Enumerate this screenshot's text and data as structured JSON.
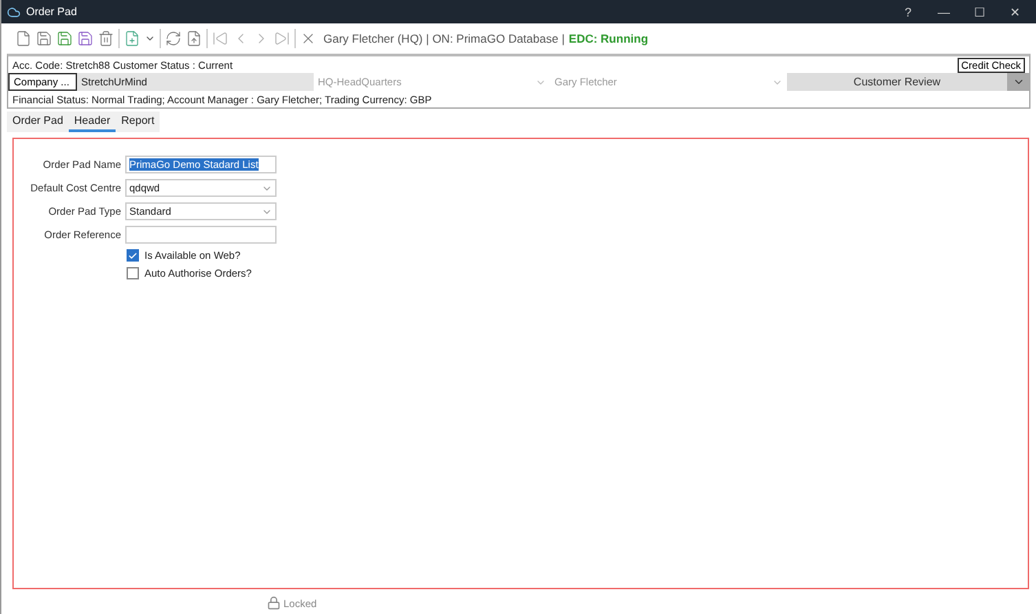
{
  "window": {
    "title": "Order Pad",
    "controls": [
      "?",
      "—",
      "☐",
      "✕"
    ]
  },
  "toolbar": {
    "user": "Gary Fletcher (HQ) | ON: PrimaGO Database |",
    "edc": "EDC: Running"
  },
  "customer": {
    "acc_code": "Acc. Code: Stretch88  Customer Status : Current",
    "credit_check": "Credit Check",
    "company_button": "Company ...",
    "company": "StretchUrMind",
    "branch": "HQ-HeadQuarters",
    "contact": "Gary Fletcher",
    "review": "Customer Review",
    "financial": "Financial Status: Normal Trading;  Account Manager : Gary Fletcher; Trading Currency: GBP"
  },
  "tabs": [
    {
      "label": "Order Pad",
      "selected": false
    },
    {
      "label": "Header",
      "selected": true
    },
    {
      "label": "Report",
      "selected": false
    }
  ],
  "form": {
    "fields": [
      {
        "kind": "text",
        "label": "Order Pad Name",
        "value": "PrimaGo Demo Stadard List",
        "highlighted": true
      },
      {
        "kind": "select",
        "label": "Default Cost Centre",
        "value": "qdqwd"
      },
      {
        "kind": "select",
        "label": "Order Pad Type",
        "value": "Standard"
      },
      {
        "kind": "text",
        "label": "Order Reference"
      }
    ],
    "checkboxes": [
      {
        "label": "Is Available on Web?",
        "checked": true
      },
      {
        "label": "Auto Authorise Orders?",
        "checked": false
      }
    ]
  },
  "status_bar": {
    "lock": "Locked"
  }
}
